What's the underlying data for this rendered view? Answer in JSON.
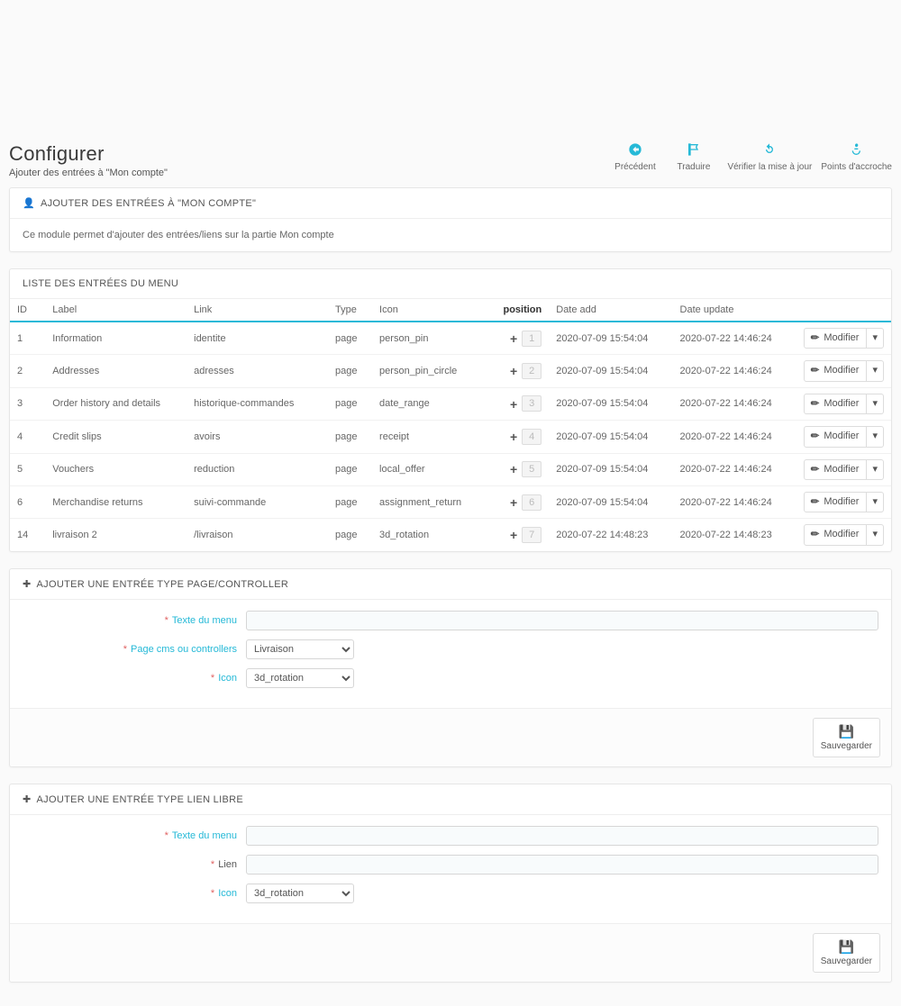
{
  "header": {
    "title": "Configurer",
    "subtitle": "Ajouter des entrées à \"Mon compte\""
  },
  "toolbar": {
    "back": "Précédent",
    "translate": "Traduire",
    "check_update": "Vérifier la mise à jour",
    "hooks": "Points d'accroche"
  },
  "panel1": {
    "title": "AJOUTER DES ENTRÉES À \"MON COMPTE\"",
    "text": "Ce module permet d'ajouter des entrées/liens sur la partie Mon compte"
  },
  "panel2": {
    "title": "LISTE DES ENTRÉES DU MENU",
    "cols": {
      "id": "ID",
      "label": "Label",
      "link": "Link",
      "type": "Type",
      "icon": "Icon",
      "position": "position",
      "date_add": "Date add",
      "date_update": "Date update"
    },
    "modify": "Modifier",
    "rows": [
      {
        "id": "1",
        "label": "Information",
        "link": "identite",
        "type": "page",
        "icon": "person_pin",
        "pos": "1",
        "da": "2020-07-09 15:54:04",
        "du": "2020-07-22 14:46:24"
      },
      {
        "id": "2",
        "label": "Addresses",
        "link": "adresses",
        "type": "page",
        "icon": "person_pin_circle",
        "pos": "2",
        "da": "2020-07-09 15:54:04",
        "du": "2020-07-22 14:46:24"
      },
      {
        "id": "3",
        "label": "Order history and details",
        "link": "historique-commandes",
        "type": "page",
        "icon": "date_range",
        "pos": "3",
        "da": "2020-07-09 15:54:04",
        "du": "2020-07-22 14:46:24"
      },
      {
        "id": "4",
        "label": "Credit slips",
        "link": "avoirs",
        "type": "page",
        "icon": "receipt",
        "pos": "4",
        "da": "2020-07-09 15:54:04",
        "du": "2020-07-22 14:46:24"
      },
      {
        "id": "5",
        "label": "Vouchers",
        "link": "reduction",
        "type": "page",
        "icon": "local_offer",
        "pos": "5",
        "da": "2020-07-09 15:54:04",
        "du": "2020-07-22 14:46:24"
      },
      {
        "id": "6",
        "label": "Merchandise returns",
        "link": "suivi-commande",
        "type": "page",
        "icon": "assignment_return",
        "pos": "6",
        "da": "2020-07-09 15:54:04",
        "du": "2020-07-22 14:46:24"
      },
      {
        "id": "14",
        "label": "livraison 2",
        "link": "/livraison",
        "type": "page",
        "icon": "3d_rotation",
        "pos": "7",
        "da": "2020-07-22 14:48:23",
        "du": "2020-07-22 14:48:23"
      }
    ]
  },
  "panel3": {
    "title": "AJOUTER UNE ENTRÉE TYPE PAGE/CONTROLLER",
    "labels": {
      "text": "Texte du menu",
      "page": "Page cms ou controllers",
      "icon": "Icon"
    },
    "values": {
      "text": "",
      "page": "Livraison",
      "icon": "3d_rotation"
    },
    "save": "Sauvegarder"
  },
  "panel4": {
    "title": "AJOUTER UNE ENTRÉE TYPE LIEN LIBRE",
    "labels": {
      "text": "Texte du menu",
      "link": "Lien",
      "icon": "Icon"
    },
    "values": {
      "text": "",
      "link": "",
      "icon": "3d_rotation"
    },
    "save": "Sauvegarder"
  }
}
